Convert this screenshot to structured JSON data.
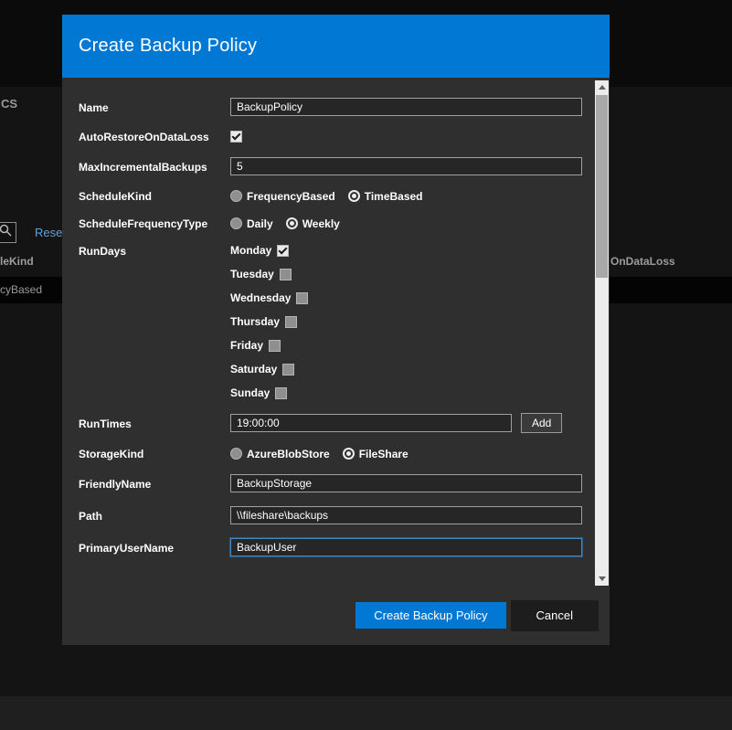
{
  "page": {
    "fragments": {
      "cs": "CS",
      "reset": "Reset",
      "lekind": "leKind",
      "ondataloss": "OnDataLoss",
      "cybased": "cyBased"
    }
  },
  "modal": {
    "title": "Create Backup Policy",
    "fields": {
      "name": {
        "label": "Name",
        "value": "BackupPolicy"
      },
      "autoRestoreOnDataLoss": {
        "label": "AutoRestoreOnDataLoss",
        "checked": true
      },
      "maxIncrementalBackups": {
        "label": "MaxIncrementalBackups",
        "value": "5"
      },
      "scheduleKind": {
        "label": "ScheduleKind",
        "options": [
          {
            "label": "FrequencyBased",
            "selected": false
          },
          {
            "label": "TimeBased",
            "selected": true
          }
        ]
      },
      "scheduleFrequencyType": {
        "label": "ScheduleFrequencyType",
        "options": [
          {
            "label": "Daily",
            "selected": false
          },
          {
            "label": "Weekly",
            "selected": true
          }
        ]
      },
      "runDays": {
        "label": "RunDays",
        "days": [
          {
            "label": "Monday",
            "checked": true
          },
          {
            "label": "Tuesday",
            "checked": false
          },
          {
            "label": "Wednesday",
            "checked": false
          },
          {
            "label": "Thursday",
            "checked": false
          },
          {
            "label": "Friday",
            "checked": false
          },
          {
            "label": "Saturday",
            "checked": false
          },
          {
            "label": "Sunday",
            "checked": false
          }
        ]
      },
      "runTimes": {
        "label": "RunTimes",
        "value": "19:00:00",
        "add_label": "Add"
      },
      "storageKind": {
        "label": "StorageKind",
        "options": [
          {
            "label": "AzureBlobStore",
            "selected": false
          },
          {
            "label": "FileShare",
            "selected": true
          }
        ]
      },
      "friendlyName": {
        "label": "FriendlyName",
        "value": "BackupStorage"
      },
      "path": {
        "label": "Path",
        "value": "\\\\fileshare\\backups"
      },
      "primaryUserName": {
        "label": "PrimaryUserName",
        "value": "BackupUser"
      }
    },
    "footer": {
      "submit_label": "Create Backup Policy",
      "cancel_label": "Cancel"
    }
  },
  "colors": {
    "header_blue": "#0078d4",
    "modal_bg": "#2f2f2f",
    "page_bg": "#141414"
  }
}
